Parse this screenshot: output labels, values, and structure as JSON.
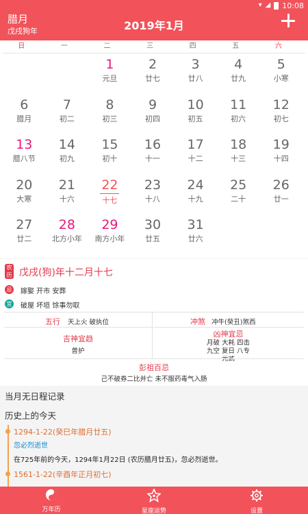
{
  "status": {
    "time": "10:08"
  },
  "header": {
    "lunar_month": "腊月",
    "lunar_year": "戊戌狗年",
    "title": "2019年1月"
  },
  "weekdays": [
    "日",
    "一",
    "二",
    "三",
    "四",
    "五",
    "六"
  ],
  "calendar": {
    "rows": [
      [
        {
          "d": "",
          "l": ""
        },
        {
          "d": "",
          "l": ""
        },
        {
          "d": "1",
          "l": "元旦",
          "hol": true
        },
        {
          "d": "2",
          "l": "廿七"
        },
        {
          "d": "3",
          "l": "廿八"
        },
        {
          "d": "4",
          "l": "廿九"
        },
        {
          "d": "5",
          "l": "小寒"
        }
      ],
      [
        {
          "d": "6",
          "l": "腊月"
        },
        {
          "d": "7",
          "l": "初二"
        },
        {
          "d": "8",
          "l": "初三"
        },
        {
          "d": "9",
          "l": "初四"
        },
        {
          "d": "10",
          "l": "初五"
        },
        {
          "d": "11",
          "l": "初六"
        },
        {
          "d": "12",
          "l": "初七"
        }
      ],
      [
        {
          "d": "13",
          "l": "腊八节",
          "hol": true
        },
        {
          "d": "14",
          "l": "初九"
        },
        {
          "d": "15",
          "l": "初十"
        },
        {
          "d": "16",
          "l": "十一"
        },
        {
          "d": "17",
          "l": "十二"
        },
        {
          "d": "18",
          "l": "十三"
        },
        {
          "d": "19",
          "l": "十四"
        }
      ],
      [
        {
          "d": "20",
          "l": "大寒"
        },
        {
          "d": "21",
          "l": "十六"
        },
        {
          "d": "22",
          "l": "十七",
          "today": true
        },
        {
          "d": "23",
          "l": "十八"
        },
        {
          "d": "24",
          "l": "十九"
        },
        {
          "d": "25",
          "l": "二十"
        },
        {
          "d": "26",
          "l": "廿一"
        }
      ],
      [
        {
          "d": "27",
          "l": "廿二"
        },
        {
          "d": "28",
          "l": "北方小年",
          "hol": true
        },
        {
          "d": "29",
          "l": "南方小年",
          "hol": true
        },
        {
          "d": "30",
          "l": "廿五"
        },
        {
          "d": "31",
          "l": "廿六"
        },
        {
          "d": "",
          "l": ""
        },
        {
          "d": "",
          "l": ""
        }
      ]
    ]
  },
  "detail": {
    "nong_badge": "农历",
    "lunar_date": "戊戌(狗)年十二月十七",
    "ji_badge": "忌",
    "ji": "嫁娶 开市 安葬",
    "yi_badge": "宜",
    "yi": "破屋 坏垣 馀事勿取",
    "wuxing_label": "五行",
    "wuxing_value": "天上火 破执位",
    "chongsha_label": "冲煞",
    "chongsha_value": "冲牛(癸丑)煞西",
    "jishen_label": "吉神宜趋",
    "jishen_value": "普护",
    "xiongshen_label": "凶神宜忌",
    "xiongshen_line1": "月破 大耗 四击",
    "xiongshen_line2": "九空 复日 八专",
    "xiongshen_line3": "元武",
    "pengzu_label": "彭祖百忌",
    "pengzu_value": "己不破券二比并亡 未不服药毒气入肠"
  },
  "schedule_text": "当月无日程记录",
  "history": {
    "title": "历史上的今天",
    "events": [
      {
        "date": "1294-1-22(癸巳年腊月廿五)",
        "name": "忽必烈逝世",
        "desc": "在725年前的今天，1294年1月22日 (农历腊月廿五)，忽必烈逝世。"
      },
      {
        "date": "1561-1-22(辛酉年正月初七)",
        "name": "",
        "desc": ""
      }
    ]
  },
  "bottom_nav": [
    {
      "label": "万年历",
      "icon": "yin-yang-icon"
    },
    {
      "label": "星座运势",
      "icon": "star-icon"
    },
    {
      "label": "设置",
      "icon": "gear-icon"
    }
  ],
  "colors": {
    "primary": "#f2525a",
    "accent_red": "#e43a4b",
    "holiday": "#e9177a",
    "yi_green": "#14a59b",
    "history_orange": "#f3a14a"
  }
}
